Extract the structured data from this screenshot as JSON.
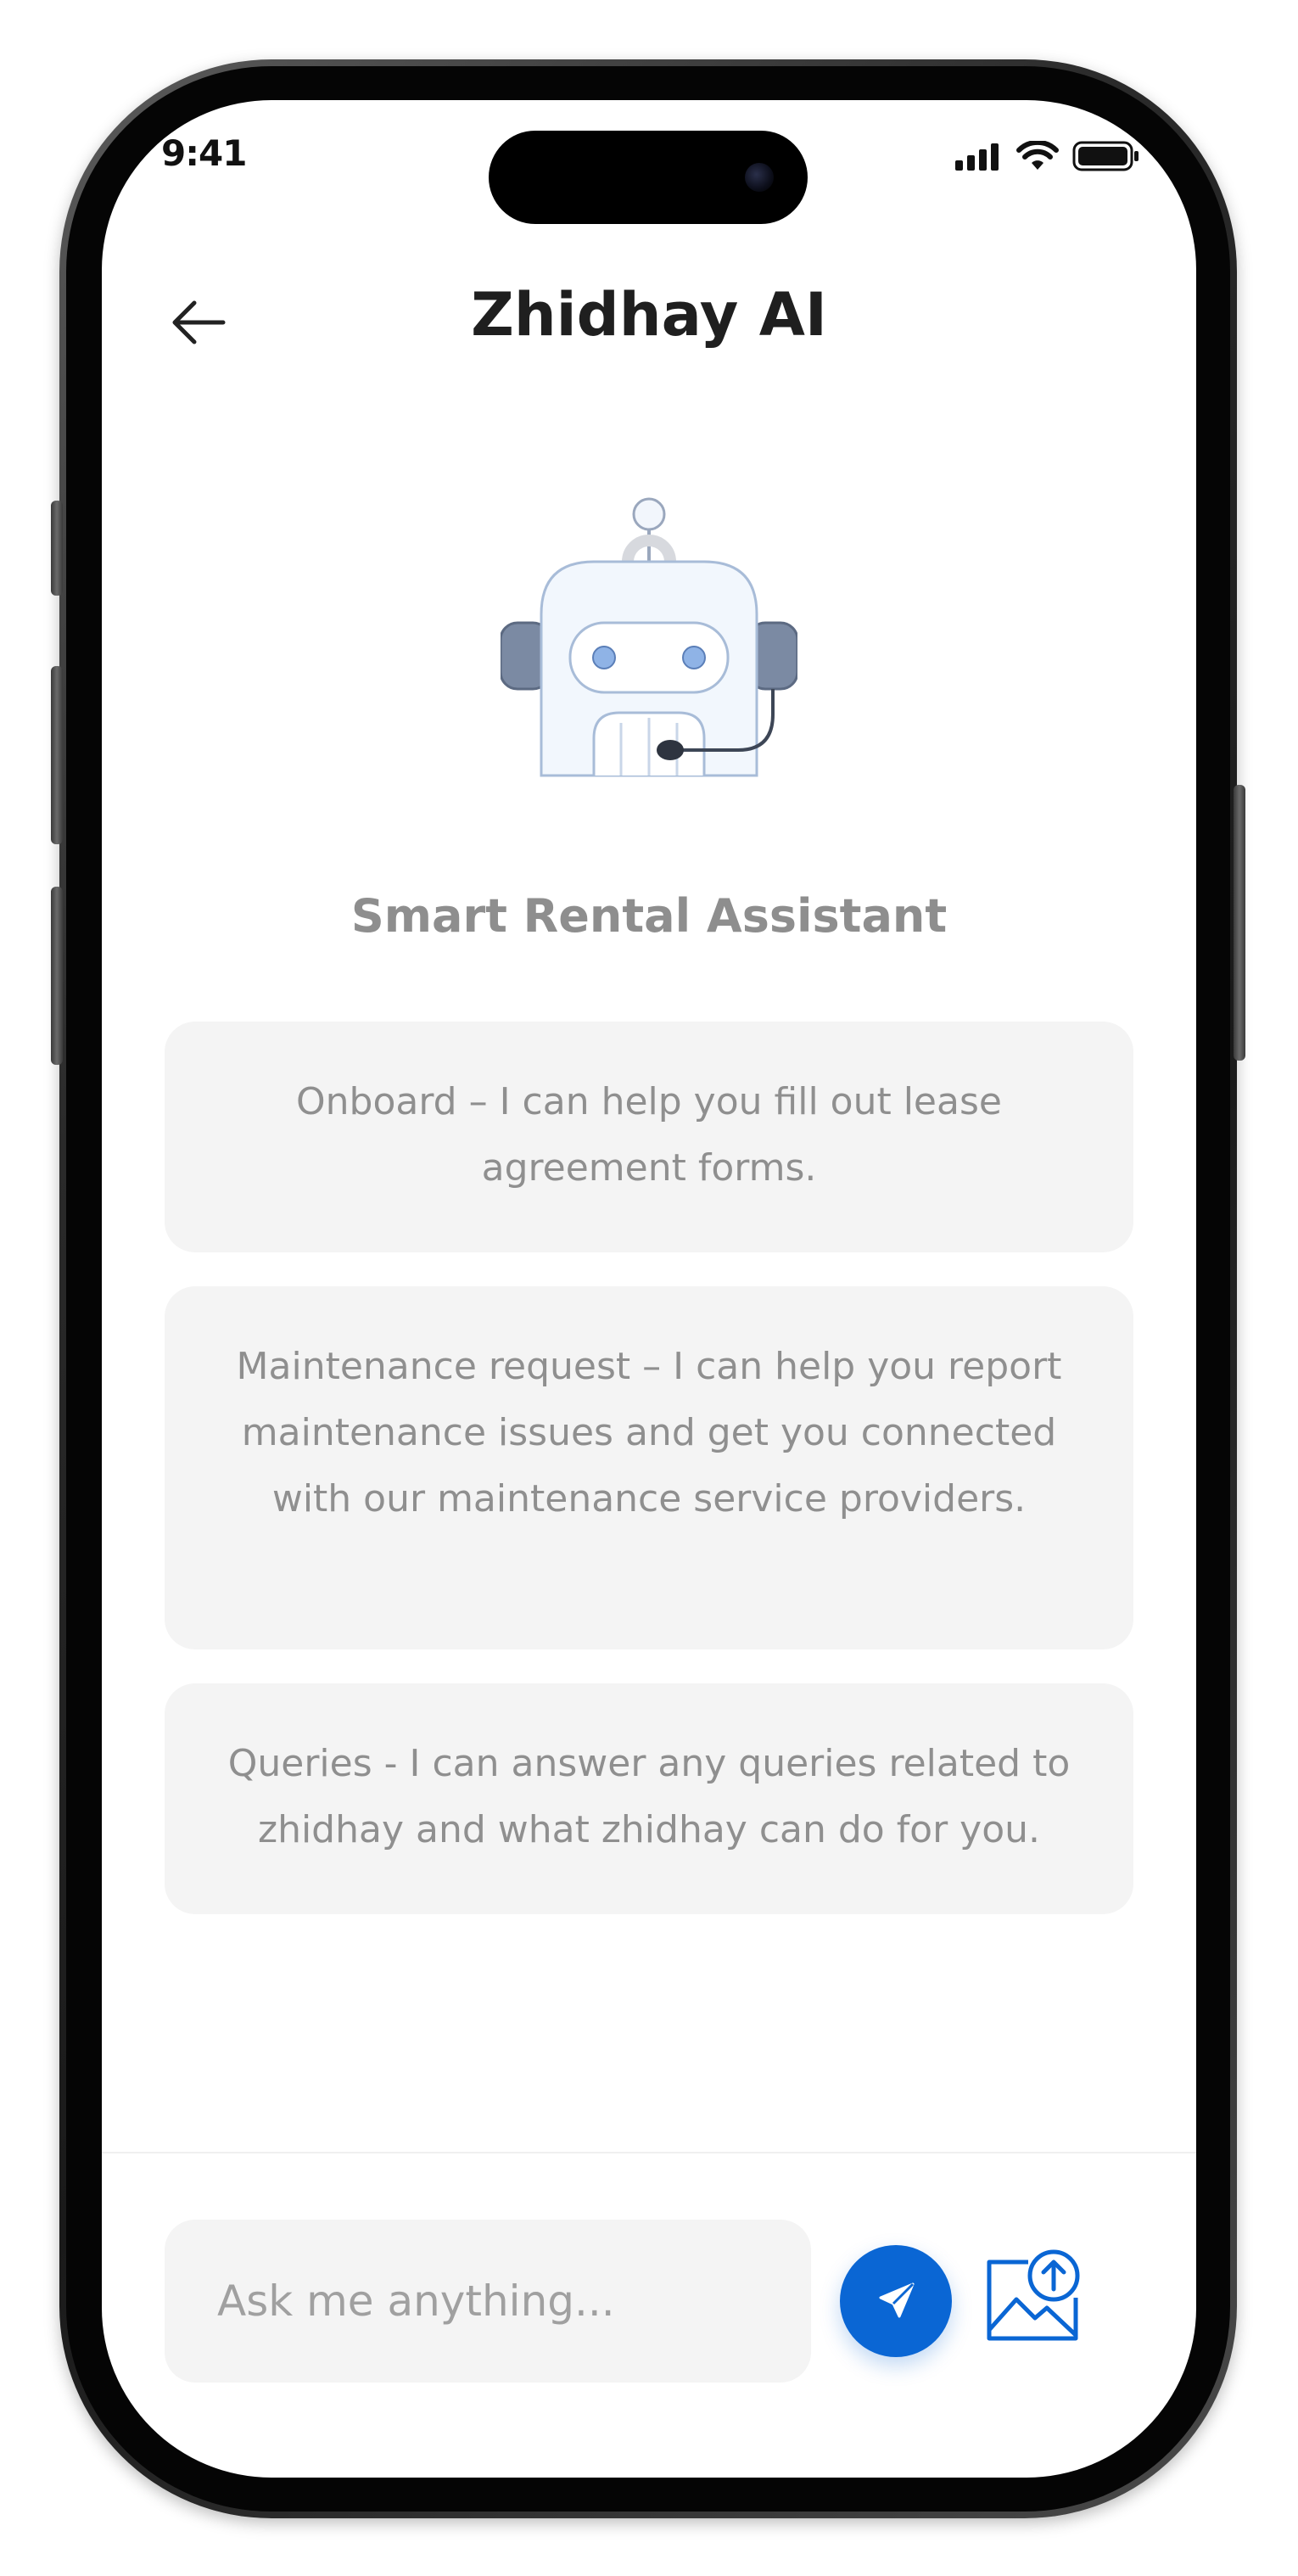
{
  "status_bar": {
    "time": "9:41"
  },
  "header": {
    "title": "Zhidhay AI",
    "back_icon": "arrow-left-icon"
  },
  "assistant": {
    "title": "Smart Rental Assistant",
    "avatar_icon": "robot-headset-icon"
  },
  "cards": [
    {
      "text": "Onboard – I can help you fill out lease agreement forms."
    },
    {
      "text": "Maintenance request –  I can help you report maintenance issues and get you connected with our maintenance service providers."
    },
    {
      "text": "Queries - I can answer any queries related to zhidhay and what zhidhay can do for you."
    }
  ],
  "composer": {
    "input_value": "",
    "placeholder": "Ask me anything...",
    "send_icon": "paper-plane-icon",
    "upload_icon": "image-upload-icon"
  },
  "colors": {
    "accent": "#0a66d4",
    "card_bg": "#f4f4f4",
    "muted_text": "#8f8f8f",
    "title_text": "#1f1f1f"
  }
}
